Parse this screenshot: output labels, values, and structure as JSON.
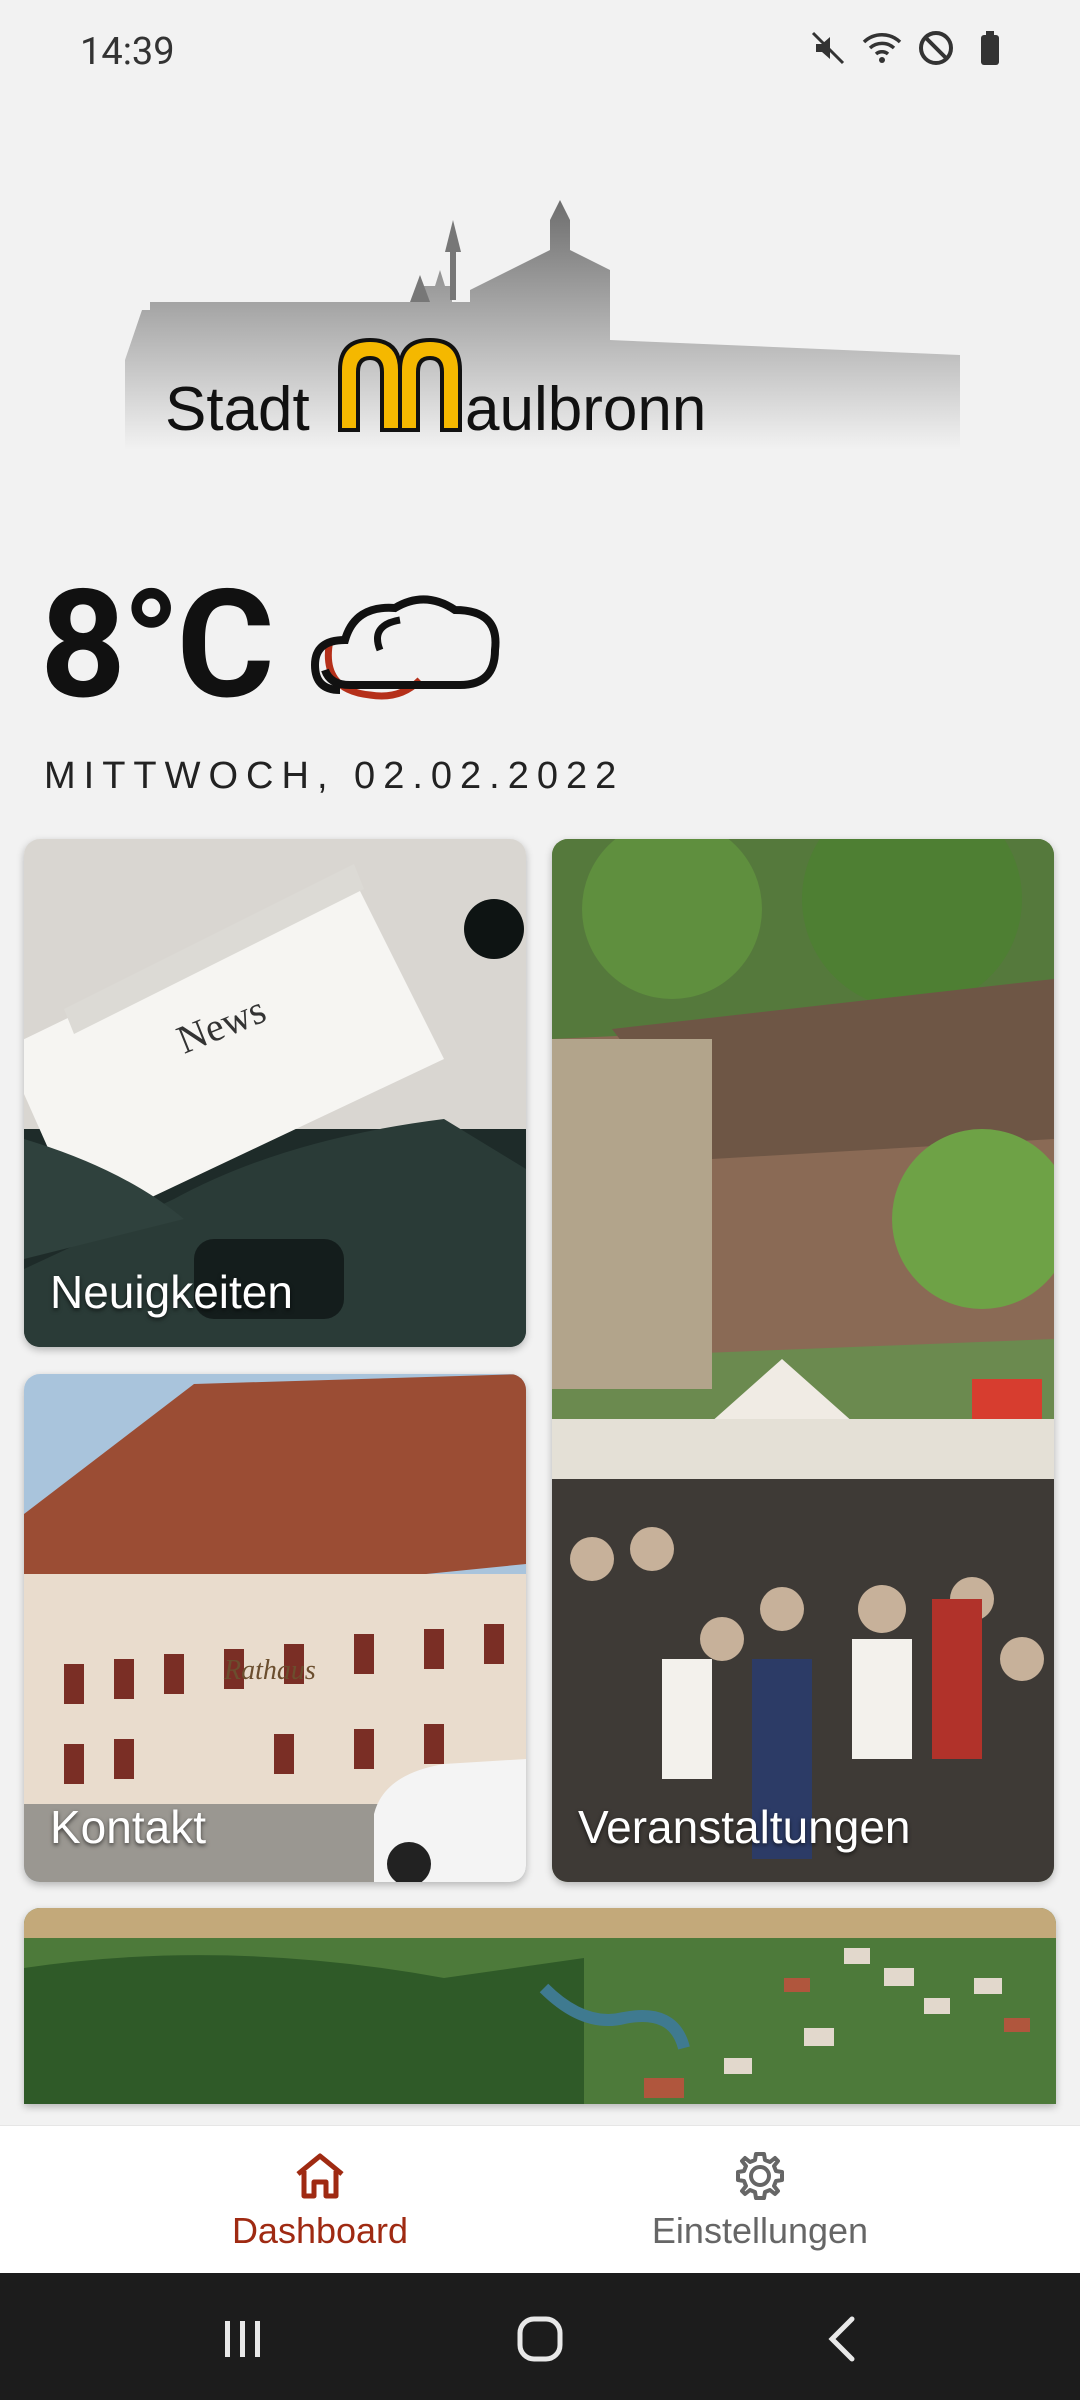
{
  "status_bar": {
    "time": "14:39",
    "icons": [
      "mute-icon",
      "wifi-icon",
      "do-not-disturb-icon",
      "battery-icon"
    ]
  },
  "logo": {
    "text_prefix": "Stadt",
    "text_suffix": "aulbronn",
    "letter": "M",
    "accent_color": "#f5b800"
  },
  "weather": {
    "temperature": "8°C",
    "icon": "cloud-icon"
  },
  "date": "MITTWOCH, 02.02.2022",
  "tiles": [
    {
      "label": "Neuigkeiten",
      "image": "typewriter-news"
    },
    {
      "label": "Kontakt",
      "image": "rathaus-building"
    },
    {
      "label": "Veranstaltungen",
      "image": "medieval-festival"
    },
    {
      "label": "",
      "image": "aerial-landscape"
    }
  ],
  "bottom_nav": {
    "items": [
      {
        "label": "Dashboard",
        "icon": "home-icon",
        "active": true
      },
      {
        "label": "Einstellungen",
        "icon": "gear-icon",
        "active": false
      }
    ],
    "active_color": "#9f2a12"
  },
  "system_nav": [
    "recents-icon",
    "home-button-icon",
    "back-icon"
  ]
}
